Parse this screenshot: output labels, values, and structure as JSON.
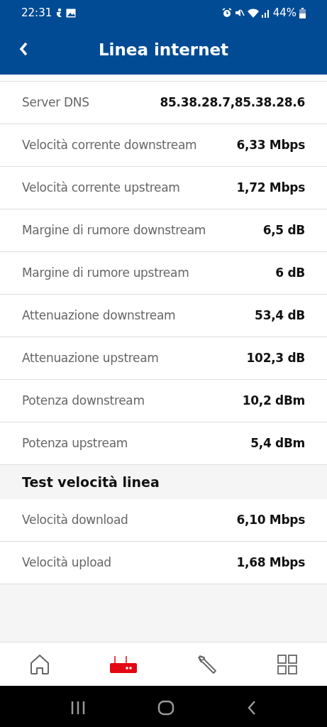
{
  "status_bar": {
    "time": "22:31",
    "battery": "44%"
  },
  "header": {
    "title": "Linea internet"
  },
  "rows": [
    {
      "label": "Server DNS",
      "value": "85.38.28.7,85.38.28.6"
    },
    {
      "label": "Velocità corrente downstream",
      "value": "6,33 Mbps"
    },
    {
      "label": "Velocità corrente upstream",
      "value": "1,72 Mbps"
    },
    {
      "label": "Margine di rumore downstream",
      "value": "6,5 dB"
    },
    {
      "label": "Margine di rumore upstream",
      "value": "6 dB"
    },
    {
      "label": "Attenuazione downstream",
      "value": "53,4 dB"
    },
    {
      "label": "Attenuazione upstream",
      "value": "102,3 dB"
    },
    {
      "label": "Potenza downstream",
      "value": "10,2 dBm"
    },
    {
      "label": "Potenza upstream",
      "value": "5,4 dBm"
    }
  ],
  "speed_test": {
    "title": "Test velocità linea",
    "rows": [
      {
        "label": "Velocità download",
        "value": "6,10 Mbps"
      },
      {
        "label": "Velocità upload",
        "value": "1,68 Mbps"
      }
    ]
  },
  "bottom_nav": [
    {
      "kind": "home",
      "selected": false
    },
    {
      "kind": "router",
      "selected": true
    },
    {
      "kind": "tools",
      "selected": false
    },
    {
      "kind": "grid",
      "selected": false
    }
  ]
}
